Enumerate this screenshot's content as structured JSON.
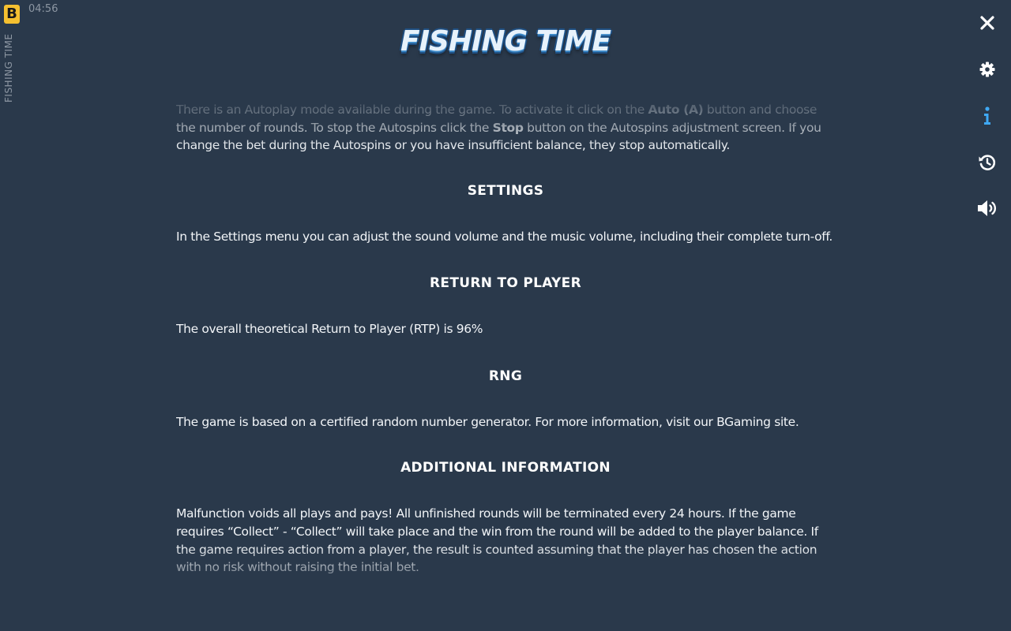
{
  "brand": {
    "letter": "B",
    "accent": "#f5c030"
  },
  "status": {
    "time": "04:56"
  },
  "game": {
    "side_title": "FISHING TIME",
    "logo_text": "FISHING TIME"
  },
  "rail": {
    "close": {
      "icon": "close-icon"
    },
    "settings": {
      "icon": "gear-icon"
    },
    "info": {
      "icon": "info-icon",
      "active_color": "#3fa9f5"
    },
    "history": {
      "icon": "history-icon"
    },
    "sound": {
      "icon": "speaker-icon"
    }
  },
  "rules": {
    "autoplay": {
      "t1": "There is an Autoplay mode available during the game. To activate it click on the ",
      "b1": "Auto (A)",
      "t2": " button and choose the number of rounds. To stop the Autospins click the ",
      "b2": "Stop",
      "t3": " button on the Autospins adjustment screen. If you change the bet during the Autospins or you have insufficient balance, they stop automatically."
    },
    "settings": {
      "heading": "SETTINGS",
      "text": "In the Settings menu you can adjust the sound volume and the music volume, including their complete turn-off."
    },
    "rtp": {
      "heading": "RETURN TO PLAYER",
      "text": "The overall theoretical Return to Player (RTP) is 96%"
    },
    "rng": {
      "heading": "RNG",
      "text": "The game is based on a certified random number generator. For more information, visit our BGaming site."
    },
    "additional": {
      "heading": "ADDITIONAL INFORMATION",
      "text": "Malfunction voids all plays and pays! All unfinished rounds will be terminated every 24 hours. If the game requires “Collect” - “Collect” will take place and the win from the round will be added to the player balance. If the game requires action from a player, the result is counted assuming that the player has chosen the action with no risk without raising the initial bet."
    }
  }
}
